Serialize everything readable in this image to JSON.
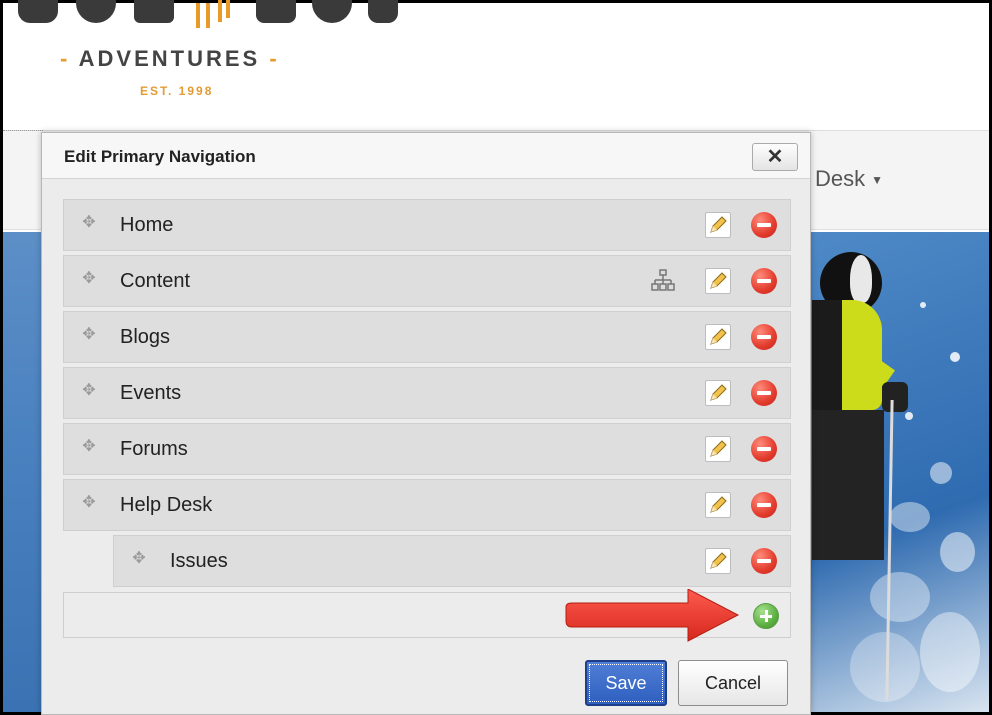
{
  "site": {
    "logo_sub": "ADVENTURES",
    "logo_est": "EST. 1998",
    "nav_visible_item": "Desk"
  },
  "dialog": {
    "title": "Edit Primary Navigation",
    "close_label": "✕",
    "items": [
      {
        "label": "Home",
        "level": 0,
        "has_tree": false
      },
      {
        "label": "Content",
        "level": 0,
        "has_tree": true
      },
      {
        "label": "Blogs",
        "level": 0,
        "has_tree": false
      },
      {
        "label": "Events",
        "level": 0,
        "has_tree": false
      },
      {
        "label": "Forums",
        "level": 0,
        "has_tree": false
      },
      {
        "label": "Help Desk",
        "level": 0,
        "has_tree": false
      },
      {
        "label": "Issues",
        "level": 1,
        "has_tree": false
      }
    ],
    "save_label": "Save",
    "cancel_label": "Cancel"
  },
  "icons": {
    "drag": "move-handle-icon",
    "edit": "pencil-icon",
    "remove": "minus-circle-icon",
    "tree": "sitemap-icon",
    "add": "plus-circle-icon"
  },
  "colors": {
    "remove": "#e23b2d",
    "add": "#5fb143",
    "save_button": "#2f5fbf",
    "arrow": "#e53935",
    "logo_accent": "#e89a2b"
  }
}
